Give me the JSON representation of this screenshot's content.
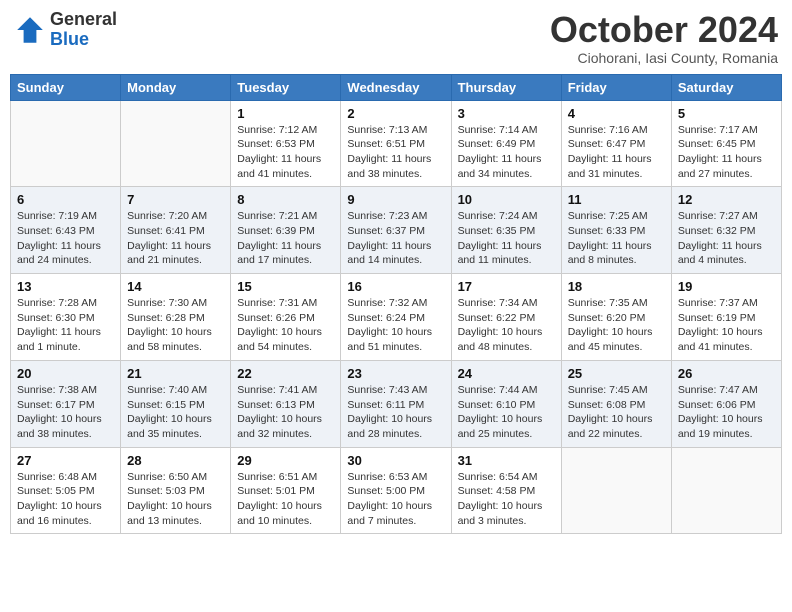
{
  "header": {
    "logo_general": "General",
    "logo_blue": "Blue",
    "month_title": "October 2024",
    "subtitle": "Ciohorani, Iasi County, Romania"
  },
  "days_of_week": [
    "Sunday",
    "Monday",
    "Tuesday",
    "Wednesday",
    "Thursday",
    "Friday",
    "Saturday"
  ],
  "weeks": [
    [
      {
        "day": "",
        "info": ""
      },
      {
        "day": "",
        "info": ""
      },
      {
        "day": "1",
        "info": "Sunrise: 7:12 AM\nSunset: 6:53 PM\nDaylight: 11 hours and 41 minutes."
      },
      {
        "day": "2",
        "info": "Sunrise: 7:13 AM\nSunset: 6:51 PM\nDaylight: 11 hours and 38 minutes."
      },
      {
        "day": "3",
        "info": "Sunrise: 7:14 AM\nSunset: 6:49 PM\nDaylight: 11 hours and 34 minutes."
      },
      {
        "day": "4",
        "info": "Sunrise: 7:16 AM\nSunset: 6:47 PM\nDaylight: 11 hours and 31 minutes."
      },
      {
        "day": "5",
        "info": "Sunrise: 7:17 AM\nSunset: 6:45 PM\nDaylight: 11 hours and 27 minutes."
      }
    ],
    [
      {
        "day": "6",
        "info": "Sunrise: 7:19 AM\nSunset: 6:43 PM\nDaylight: 11 hours and 24 minutes."
      },
      {
        "day": "7",
        "info": "Sunrise: 7:20 AM\nSunset: 6:41 PM\nDaylight: 11 hours and 21 minutes."
      },
      {
        "day": "8",
        "info": "Sunrise: 7:21 AM\nSunset: 6:39 PM\nDaylight: 11 hours and 17 minutes."
      },
      {
        "day": "9",
        "info": "Sunrise: 7:23 AM\nSunset: 6:37 PM\nDaylight: 11 hours and 14 minutes."
      },
      {
        "day": "10",
        "info": "Sunrise: 7:24 AM\nSunset: 6:35 PM\nDaylight: 11 hours and 11 minutes."
      },
      {
        "day": "11",
        "info": "Sunrise: 7:25 AM\nSunset: 6:33 PM\nDaylight: 11 hours and 8 minutes."
      },
      {
        "day": "12",
        "info": "Sunrise: 7:27 AM\nSunset: 6:32 PM\nDaylight: 11 hours and 4 minutes."
      }
    ],
    [
      {
        "day": "13",
        "info": "Sunrise: 7:28 AM\nSunset: 6:30 PM\nDaylight: 11 hours and 1 minute."
      },
      {
        "day": "14",
        "info": "Sunrise: 7:30 AM\nSunset: 6:28 PM\nDaylight: 10 hours and 58 minutes."
      },
      {
        "day": "15",
        "info": "Sunrise: 7:31 AM\nSunset: 6:26 PM\nDaylight: 10 hours and 54 minutes."
      },
      {
        "day": "16",
        "info": "Sunrise: 7:32 AM\nSunset: 6:24 PM\nDaylight: 10 hours and 51 minutes."
      },
      {
        "day": "17",
        "info": "Sunrise: 7:34 AM\nSunset: 6:22 PM\nDaylight: 10 hours and 48 minutes."
      },
      {
        "day": "18",
        "info": "Sunrise: 7:35 AM\nSunset: 6:20 PM\nDaylight: 10 hours and 45 minutes."
      },
      {
        "day": "19",
        "info": "Sunrise: 7:37 AM\nSunset: 6:19 PM\nDaylight: 10 hours and 41 minutes."
      }
    ],
    [
      {
        "day": "20",
        "info": "Sunrise: 7:38 AM\nSunset: 6:17 PM\nDaylight: 10 hours and 38 minutes."
      },
      {
        "day": "21",
        "info": "Sunrise: 7:40 AM\nSunset: 6:15 PM\nDaylight: 10 hours and 35 minutes."
      },
      {
        "day": "22",
        "info": "Sunrise: 7:41 AM\nSunset: 6:13 PM\nDaylight: 10 hours and 32 minutes."
      },
      {
        "day": "23",
        "info": "Sunrise: 7:43 AM\nSunset: 6:11 PM\nDaylight: 10 hours and 28 minutes."
      },
      {
        "day": "24",
        "info": "Sunrise: 7:44 AM\nSunset: 6:10 PM\nDaylight: 10 hours and 25 minutes."
      },
      {
        "day": "25",
        "info": "Sunrise: 7:45 AM\nSunset: 6:08 PM\nDaylight: 10 hours and 22 minutes."
      },
      {
        "day": "26",
        "info": "Sunrise: 7:47 AM\nSunset: 6:06 PM\nDaylight: 10 hours and 19 minutes."
      }
    ],
    [
      {
        "day": "27",
        "info": "Sunrise: 6:48 AM\nSunset: 5:05 PM\nDaylight: 10 hours and 16 minutes."
      },
      {
        "day": "28",
        "info": "Sunrise: 6:50 AM\nSunset: 5:03 PM\nDaylight: 10 hours and 13 minutes."
      },
      {
        "day": "29",
        "info": "Sunrise: 6:51 AM\nSunset: 5:01 PM\nDaylight: 10 hours and 10 minutes."
      },
      {
        "day": "30",
        "info": "Sunrise: 6:53 AM\nSunset: 5:00 PM\nDaylight: 10 hours and 7 minutes."
      },
      {
        "day": "31",
        "info": "Sunrise: 6:54 AM\nSunset: 4:58 PM\nDaylight: 10 hours and 3 minutes."
      },
      {
        "day": "",
        "info": ""
      },
      {
        "day": "",
        "info": ""
      }
    ]
  ]
}
